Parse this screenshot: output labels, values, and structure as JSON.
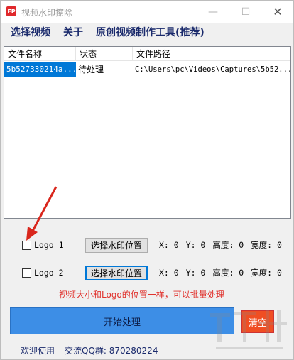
{
  "window": {
    "title": "视频水印擦除",
    "icon": "app-icon"
  },
  "menu": [
    "选择视频",
    "关于",
    "原创视频制作工具(推荐)"
  ],
  "table": {
    "columns": [
      "文件名称",
      "状态",
      "文件路径"
    ],
    "rows": [
      {
        "name": "5b527330214a...",
        "status": "待处理",
        "path": "C:\\Users\\pc\\Videos\\Captures\\5b52..."
      }
    ]
  },
  "logo1": {
    "label": "Logo 1",
    "checked": false,
    "button": "选择水印位置",
    "x": "X: 0",
    "y": "Y: 0",
    "height": "高度: 0",
    "width": "宽度: 0"
  },
  "logo2": {
    "label": "Logo 2",
    "checked": false,
    "button": "选择水印位置",
    "x": "X: 0",
    "y": "Y: 0",
    "height": "高度: 0",
    "width": "宽度: 0"
  },
  "hint": "视频大小和Logo的位置一样，可以批量处理",
  "buttons": {
    "start": "开始处理",
    "clear": "清空"
  },
  "footer": {
    "welcome": "欢迎使用",
    "qq": "交流QQ群: 870280224"
  },
  "colors": {
    "start_button": "#3d8ee6",
    "clear_button": "#f04e23",
    "hint_text": "#e0312c",
    "selection": "#0078d7"
  }
}
